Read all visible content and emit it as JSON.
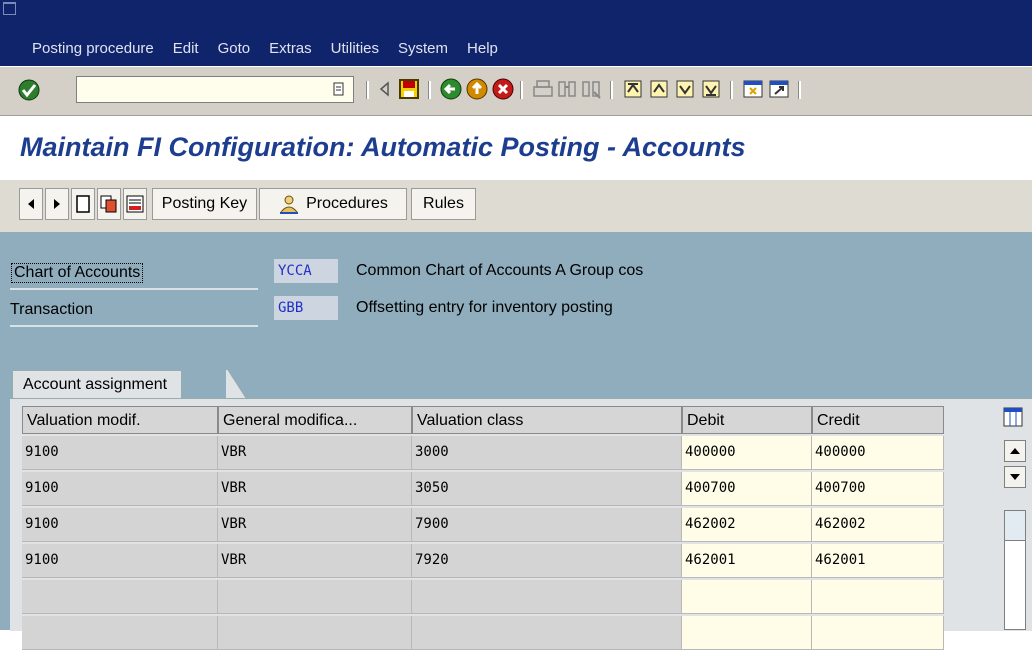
{
  "menu": [
    "Posting procedure",
    "Edit",
    "Goto",
    "Extras",
    "Utilities",
    "System",
    "Help"
  ],
  "command_field": {
    "value": ""
  },
  "page_title": "Maintain FI Configuration: Automatic Posting - Accounts",
  "app_toolbar": {
    "posting_key": "Posting Key",
    "procedures": "Procedures",
    "rules": "Rules"
  },
  "header": {
    "chart_label": "Chart of Accounts",
    "chart_value": "YCCA",
    "chart_desc": "Common Chart of Accounts A Group cos",
    "transaction_label": "Transaction",
    "transaction_value": "GBB",
    "transaction_desc": "Offsetting entry for inventory posting"
  },
  "tab": {
    "label": "Account assignment"
  },
  "table": {
    "columns": [
      "Valuation modif.",
      "General modifica...",
      "Valuation class",
      "Debit",
      "Credit"
    ],
    "rows": [
      [
        "9100",
        "VBR",
        "3000",
        "400000",
        "400000"
      ],
      [
        "9100",
        "VBR",
        "3050",
        "400700",
        "400700"
      ],
      [
        "9100",
        "VBR",
        "7900",
        "462002",
        "462002"
      ],
      [
        "9100",
        "VBR",
        "7920",
        "462001",
        "462001"
      ],
      [
        "",
        "",
        "",
        "",
        ""
      ],
      [
        "",
        "",
        "",
        "",
        ""
      ]
    ]
  },
  "icons": {
    "enter": "green-check-icon",
    "save": "save-icon",
    "back": "back-icon",
    "exit": "exit-icon",
    "cancel": "cancel-icon"
  },
  "colors": {
    "menubar": "#10246b",
    "title": "#1d3d8f",
    "header_bg": "#8fadbd",
    "input_bg": "#fffde8"
  }
}
